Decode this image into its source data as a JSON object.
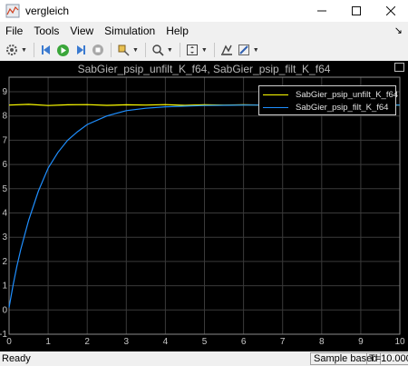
{
  "window": {
    "title": "vergleich"
  },
  "menu": {
    "items": [
      "File",
      "Tools",
      "View",
      "Simulation",
      "Help"
    ]
  },
  "toolbar": {
    "icons": [
      "gear-icon",
      "step-back-icon",
      "run-icon",
      "step-forward-icon",
      "stop-icon",
      "highlight-icon",
      "zoom-icon",
      "fit-icon",
      "cursor-measure-icon",
      "edit-icon"
    ]
  },
  "scope": {
    "title": "SabGier_psip_unfilt_K_f64, SabGier_psip_filt_K_f64",
    "colors": {
      "background": "#000000",
      "grid": "#3a3a3a",
      "unfilt": "#ffff00",
      "filt": "#1f8fff"
    }
  },
  "chart_data": {
    "type": "line",
    "title": "SabGier_psip_unfilt_K_f64, SabGier_psip_filt_K_f64",
    "xlim": [
      0,
      10
    ],
    "ylim": [
      -1,
      9.6
    ],
    "xticks": [
      0,
      1,
      2,
      3,
      4,
      5,
      6,
      7,
      8,
      9,
      10
    ],
    "yticks": [
      -1,
      0,
      1,
      2,
      3,
      4,
      5,
      6,
      7,
      8,
      9
    ],
    "grid": true,
    "legend_position": "top-right",
    "series": [
      {
        "name": "SabGier_psip_unfilt_K_f64",
        "color": "#ffff00",
        "x": [
          0,
          0.5,
          1,
          1.5,
          2,
          2.5,
          3,
          3.5,
          4,
          4.5,
          5,
          5.5,
          6,
          6.5,
          7,
          7.5,
          8,
          8.5,
          9,
          9.5,
          10
        ],
        "y": [
          8.45,
          8.48,
          8.43,
          8.46,
          8.47,
          8.44,
          8.46,
          8.45,
          8.47,
          8.44,
          8.46,
          8.45,
          8.46,
          8.45,
          8.45,
          8.46,
          8.44,
          8.46,
          8.45,
          8.46,
          8.45
        ]
      },
      {
        "name": "SabGier_psip_filt_K_f64",
        "color": "#1f8fff",
        "x": [
          0,
          0.1,
          0.2,
          0.3,
          0.5,
          0.75,
          1,
          1.25,
          1.5,
          1.75,
          2,
          2.5,
          3,
          3.5,
          4,
          5,
          6,
          7,
          8,
          9,
          10
        ],
        "y": [
          0.1,
          1.0,
          1.8,
          2.5,
          3.7,
          4.9,
          5.85,
          6.5,
          7.0,
          7.35,
          7.65,
          8.0,
          8.22,
          8.32,
          8.38,
          8.43,
          8.45,
          8.45,
          8.45,
          8.45,
          8.45
        ]
      }
    ]
  },
  "status": {
    "left": "Ready",
    "mode": "Sample based",
    "time": "T=10.000"
  }
}
